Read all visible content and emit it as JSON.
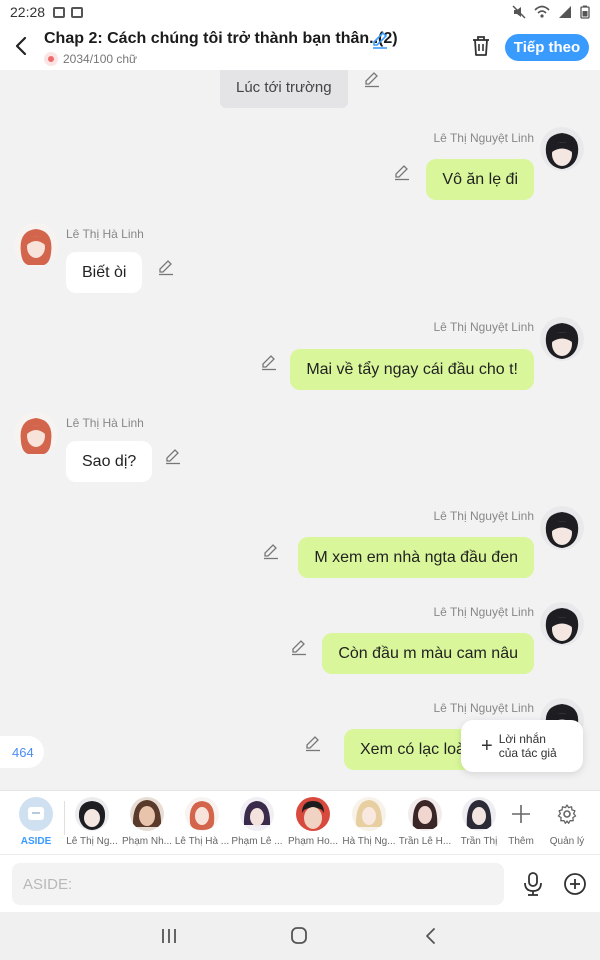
{
  "status_bar": {
    "time": "22:28"
  },
  "header": {
    "title": "Chap 2: Cách chúng tôi trở thành bạn thân..(2)",
    "word_count": "2034/100 chữ",
    "follow_label": "Tiếp theo",
    "accent_color": "#3a9bff"
  },
  "chat": {
    "narration": "Lúc tới trường",
    "messages": [
      {
        "speaker": "Lê Thị Nguyệt Linh",
        "side": "right",
        "text": "Vô ăn lẹ đi"
      },
      {
        "speaker": "Lê Thị Hà Linh",
        "side": "left",
        "text": "Biết òi"
      },
      {
        "speaker": "Lê Thị Nguyệt Linh",
        "side": "right",
        "text": "Mai về tẩy ngay cái đầu cho t!"
      },
      {
        "speaker": "Lê Thị Hà Linh",
        "side": "left",
        "text": "Sao dị?"
      },
      {
        "speaker": "Lê Thị Nguyệt Linh",
        "side": "right",
        "text": "M xem em nhà ngta đầu đen"
      },
      {
        "speaker": "Lê Thị Nguyệt Linh",
        "side": "right",
        "text": "Còn đầu m màu cam nâu"
      },
      {
        "speaker": "Lê Thị Nguyệt Linh",
        "side": "right",
        "text": "Xem có lạc loài"
      }
    ]
  },
  "message_counter": "464",
  "author_note": {
    "line1": "Lời nhắn",
    "line2": "của tác giả"
  },
  "characters": [
    {
      "label": "ASIDE"
    },
    {
      "label": "Lê Thị Ng..."
    },
    {
      "label": "Phạm Nh..."
    },
    {
      "label": "Lê Thị Hà ..."
    },
    {
      "label": "Phạm Lê ..."
    },
    {
      "label": "Phạm Ho..."
    },
    {
      "label": "Hà Thị Ng..."
    },
    {
      "label": "Trần Lê H..."
    },
    {
      "label": "Trần Thị"
    }
  ],
  "char_actions": {
    "more_label": "Thêm",
    "manage_label": "Quản lý"
  },
  "input": {
    "placeholder": "ASIDE:"
  },
  "colors": {
    "right_bubble": "#d9f79a",
    "left_bubble": "#ffffff",
    "background": "#f2f2f3"
  }
}
